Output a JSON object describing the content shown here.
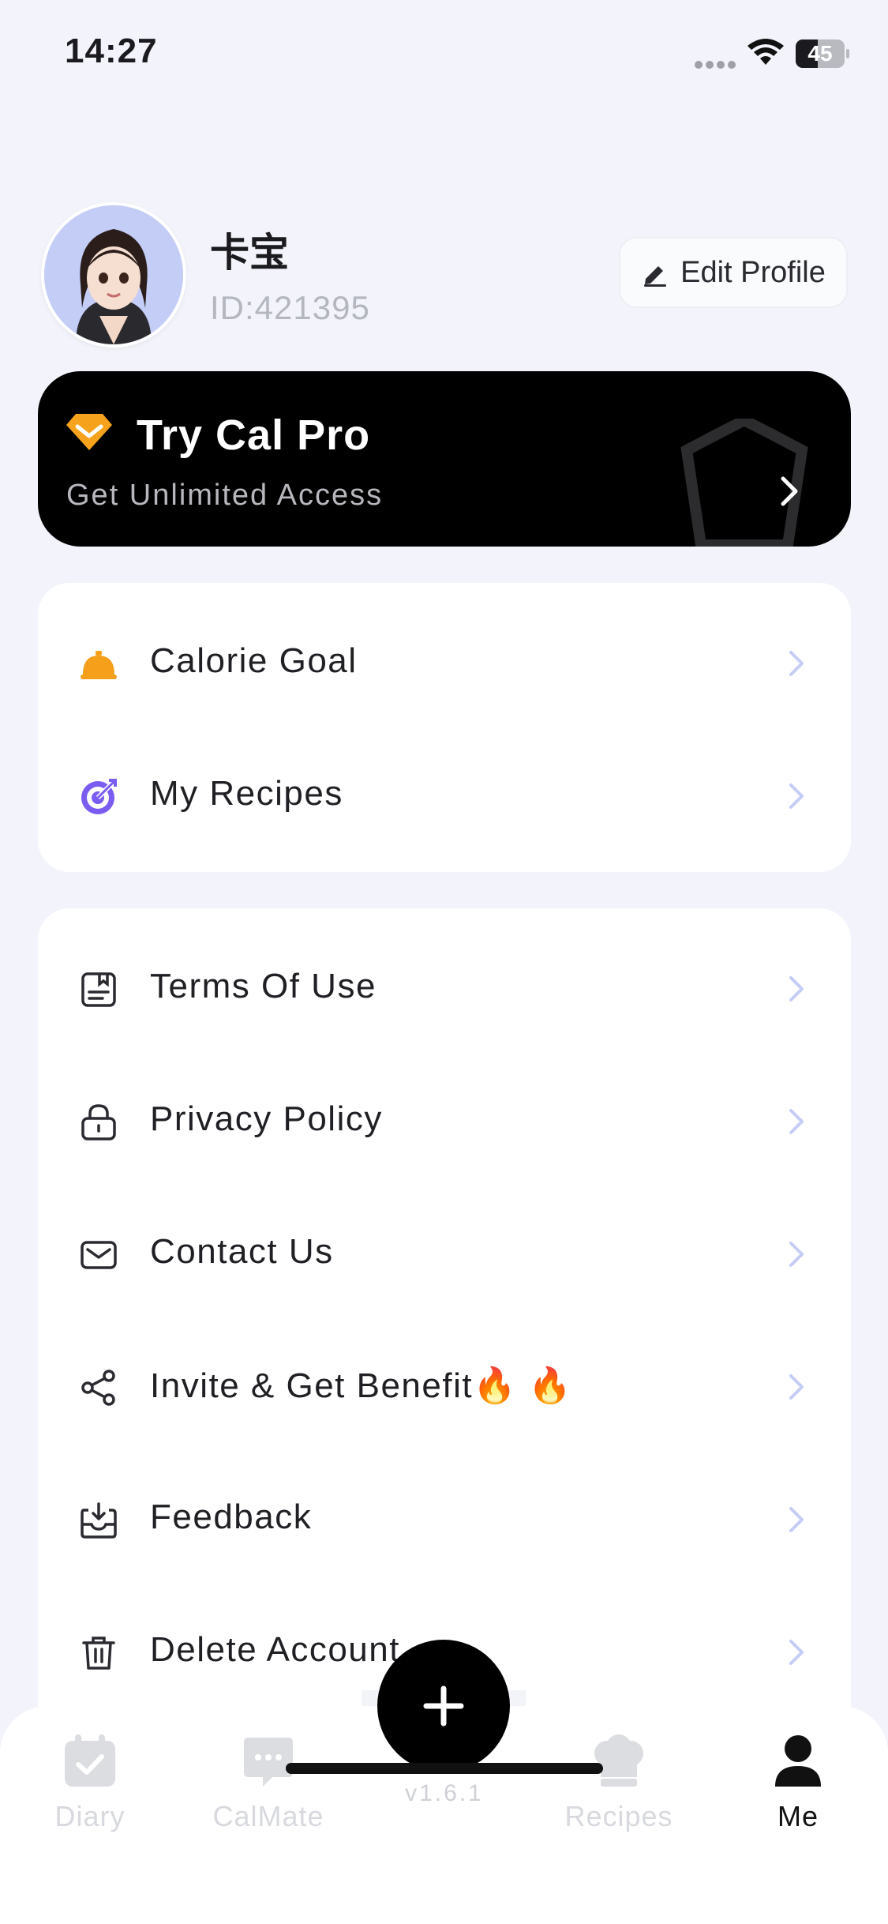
{
  "status_bar": {
    "time": "14:27",
    "battery": "45",
    "battery_level": 0.45
  },
  "profile": {
    "name": "卡宝",
    "id_text": "ID:421395",
    "edit_label": "Edit Profile"
  },
  "pro_banner": {
    "title": "Try Cal Pro",
    "subtitle": "Get Unlimited Access"
  },
  "menu_group_1": [
    {
      "label": "Calorie Goal",
      "icon": "serving-cloche-icon",
      "color": "#f59f1a"
    },
    {
      "label": "My Recipes",
      "icon": "target-icon",
      "color": "#7b5cf0"
    }
  ],
  "menu_group_2": [
    {
      "label": "Terms Of Use",
      "icon": "document-icon"
    },
    {
      "label": "Privacy Policy",
      "icon": "lock-icon"
    },
    {
      "label": "Contact Us",
      "icon": "mail-icon"
    },
    {
      "label": "Invite & Get Benefit🔥 🔥",
      "icon": "share-icon"
    },
    {
      "label": "Feedback",
      "icon": "inbox-icon"
    },
    {
      "label": "Delete Account",
      "icon": "trash-icon"
    }
  ],
  "tabbar": {
    "tabs": [
      {
        "label": "Diary",
        "icon": "calendar-check-icon",
        "active": false
      },
      {
        "label": "CalMate",
        "icon": "chat-bubble-icon",
        "active": false
      },
      {
        "label": "Recipes",
        "icon": "chef-hat-icon",
        "active": false
      },
      {
        "label": "Me",
        "icon": "person-icon",
        "active": true
      }
    ],
    "version": "v1.6.1"
  },
  "colors": {
    "accent_orange": "#f59f1a",
    "accent_purple": "#7b5cf0",
    "chevron": "#c5cdf7",
    "banner": "#000000"
  }
}
